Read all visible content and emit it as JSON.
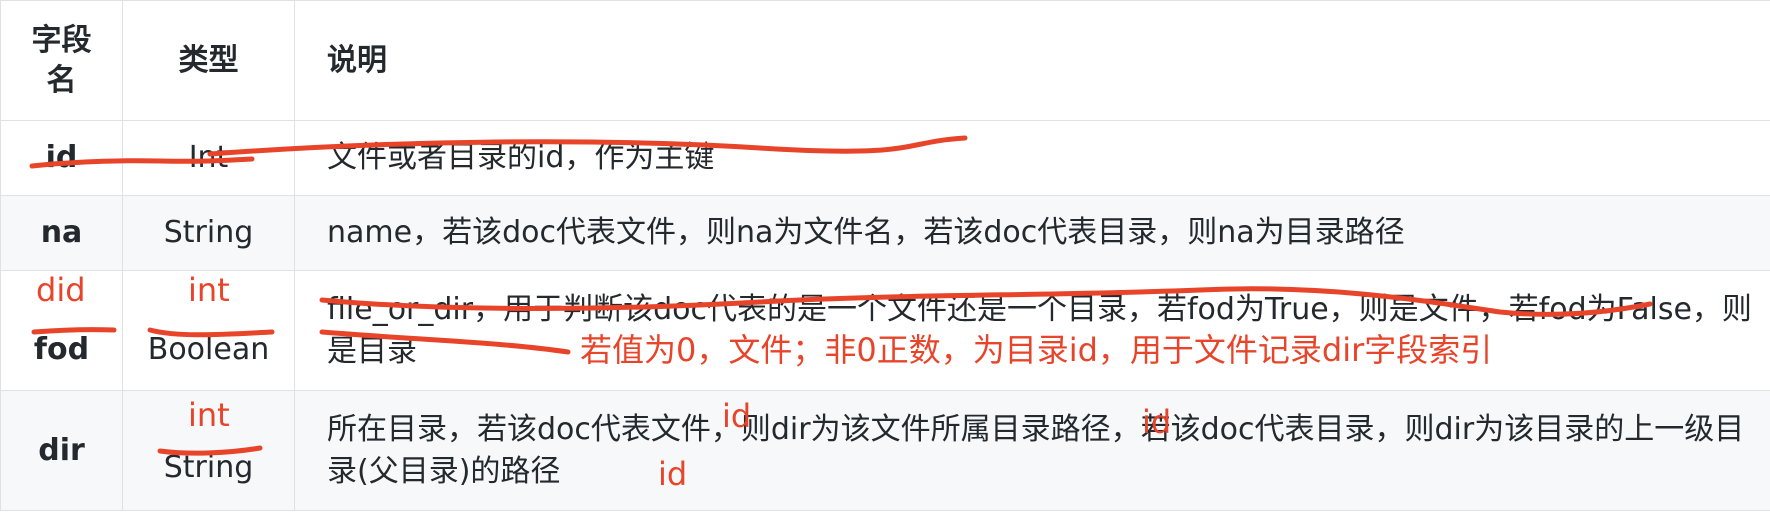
{
  "table": {
    "headers": {
      "name": "字段名",
      "type": "类型",
      "desc": "说明"
    },
    "rows": [
      {
        "name": "id",
        "type": "Int",
        "desc": "文件或者目录的id，作为主键"
      },
      {
        "name": "na",
        "type": "String",
        "desc": "name，若该doc代表文件，则na为文件名，若该doc代表目录，则na为目录路径"
      },
      {
        "name": "fod",
        "type": "Boolean",
        "desc": "file_or_dir，用于判断该doc代表的是一个文件还是一个目录，若fod为True，则是文件，若fod为False，则是目录"
      },
      {
        "name": "dir",
        "type": "String",
        "desc": "所在目录，若该doc代表文件，则dir为该文件所属目录路径，若该doc代表目录，则dir为该目录的上一级目录(父目录)的路径"
      }
    ]
  },
  "annotations": {
    "row3_name": "did",
    "row3_type": "int",
    "row3_note": "若值为0，文件；非0正数，为目录id，用于文件记录dir字段索引",
    "row4_type": "int",
    "row4_id_1": "id",
    "row4_id_2": "id",
    "row4_id_3": "id",
    "ink_color": "#e8442a"
  }
}
